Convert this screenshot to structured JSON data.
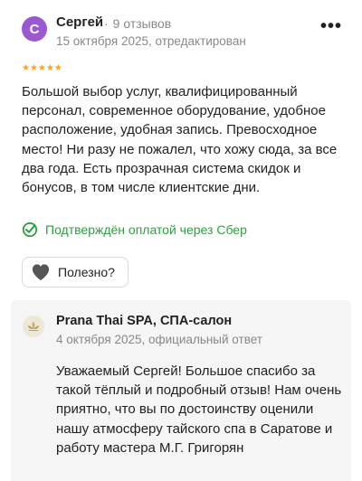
{
  "review": {
    "avatar_letter": "С",
    "avatar_color": "#9b59d0",
    "author": "Сергей",
    "separator": "·",
    "review_count": "9 отзывов",
    "date": "15 октября 2025, отредактирован",
    "more_menu": "•••",
    "rating": 5,
    "stars": "★★★★★",
    "text": "Большой выбор услуг, квалифицированный персонал, современное оборудование, удобное расположение, удобная запись. Превосходное место! Ни разу не пожалел, что хожу сюда, за все два года. Есть прозрачная система скидок и бонусов, в том числе клиентские дни.",
    "verified_label": "Подтверждён оплатой через Сбер",
    "verified_icon": "check-circle-icon",
    "helpful_label": "Полезно?",
    "helpful_icon": "heart-icon"
  },
  "reply": {
    "org_name": "Prana Thai SPA, СПА-салон",
    "meta": "4 октября 2025, официальный ответ",
    "logo_icon": "lotus-logo-icon",
    "text": "Уважаемый Сергей! Большое спасибо за такой тёплый и подробный отзыв! Нам очень приятно, что вы по достоинству оценили нашу атмосферу тайского спа в Саратове и работу мастера М.Г. Григорян"
  },
  "colors": {
    "star": "#f5a623",
    "verified": "#2e9e3f",
    "meta_gray": "#888888",
    "reply_bg": "#f5f5f5",
    "heart": "#555555"
  }
}
